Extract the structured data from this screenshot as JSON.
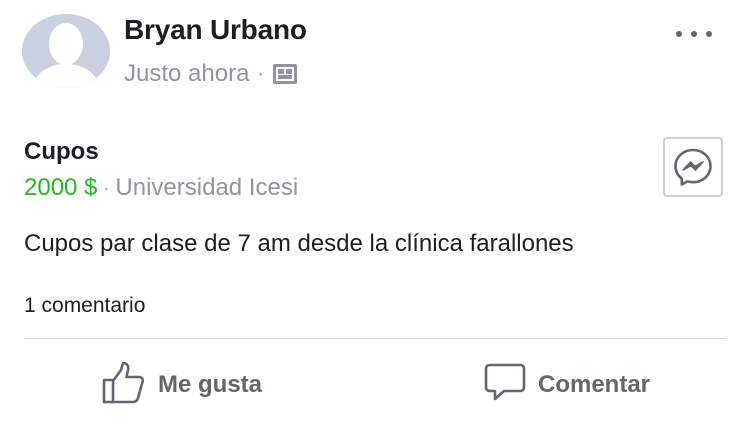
{
  "post": {
    "author": "Bryan Urbano",
    "time": "Justo ahora",
    "separator": "·",
    "audience_icon": "photo-gallery-icon",
    "more_icon": "ellipsis-icon"
  },
  "listing": {
    "title": "Cupos",
    "price": "2000 $",
    "separator": "·",
    "location": "Universidad Icesi",
    "description": "Cupos par clase de 7 am desde la clínica farallones",
    "message_icon": "messenger-icon"
  },
  "stats": {
    "comments": "1 comentario"
  },
  "actions": {
    "like_label": "Me gusta",
    "comment_label": "Comentar"
  },
  "colors": {
    "price": "#1fbb1f",
    "secondary_text": "#90949c",
    "primary_text": "#1c1e21",
    "action_text": "#606770",
    "avatar_bg": "#c9d0e2"
  }
}
